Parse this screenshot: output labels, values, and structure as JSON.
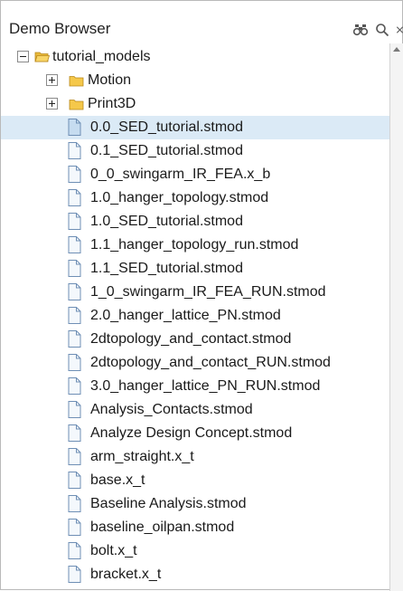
{
  "panel": {
    "title": "Demo Browser",
    "icons": [
      "binoculars-icon",
      "search-icon",
      "close-icon"
    ]
  },
  "tree": {
    "root": {
      "label": "tutorial_models",
      "expanded": true
    },
    "folders": [
      {
        "label": "Motion",
        "expanded": false
      },
      {
        "label": "Print3D",
        "expanded": false
      }
    ],
    "files": [
      {
        "label": "0.0_SED_tutorial.stmod",
        "selected": true
      },
      {
        "label": "0.1_SED_tutorial.stmod"
      },
      {
        "label": "0_0_swingarm_IR_FEA.x_b"
      },
      {
        "label": "1.0_hanger_topology.stmod"
      },
      {
        "label": "1.0_SED_tutorial.stmod"
      },
      {
        "label": "1.1_hanger_topology_run.stmod"
      },
      {
        "label": "1.1_SED_tutorial.stmod"
      },
      {
        "label": "1_0_swingarm_IR_FEA_RUN.stmod"
      },
      {
        "label": "2.0_hanger_lattice_PN.stmod"
      },
      {
        "label": "2dtopology_and_contact.stmod"
      },
      {
        "label": "2dtopology_and_contact_RUN.stmod"
      },
      {
        "label": "3.0_hanger_lattice_PN_RUN.stmod"
      },
      {
        "label": "Analysis_Contacts.stmod"
      },
      {
        "label": "Analyze Design Concept.stmod"
      },
      {
        "label": "arm_straight.x_t"
      },
      {
        "label": "base.x_t"
      },
      {
        "label": "Baseline Analysis.stmod"
      },
      {
        "label": "baseline_oilpan.stmod"
      },
      {
        "label": "bolt.x_t"
      },
      {
        "label": "bracket.x_t"
      }
    ]
  },
  "colors": {
    "selection": "#dbeaf6",
    "folder": "#f5c84a",
    "file_outline": "#6f8fb5"
  }
}
